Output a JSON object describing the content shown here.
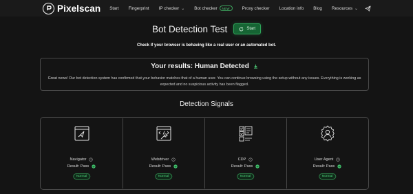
{
  "nav": {
    "brand": "Pixelscan",
    "items": [
      {
        "label": "Start",
        "chevron": false
      },
      {
        "label": "Fingerprint",
        "chevron": false
      },
      {
        "label": "IP checker",
        "chevron": true
      },
      {
        "label": "Bot checker",
        "badge": "NEW"
      },
      {
        "label": "Proxy checker",
        "chevron": false
      },
      {
        "label": "Location info",
        "chevron": false
      },
      {
        "label": "Blog",
        "chevron": false
      },
      {
        "label": "Resources",
        "chevron": true
      }
    ],
    "send_icon": "telegram-icon"
  },
  "hero": {
    "title": "Bot Detection Test",
    "start_label": "Start",
    "subtitle": "Check if your browser is behaving like a real user or an automated bot."
  },
  "result": {
    "title": "Your results: Human Detected",
    "text": "Great news! Our bot detection system has confirmed that your behavior matches that of a human user. You can continue browsing using the setup without any issues. Everything is working as expected and no suspicious activity has been flagged."
  },
  "signals": {
    "title": "Detection Signals",
    "cards": [
      {
        "name": "Navigator",
        "result": "Result: Pass",
        "status": "Normal",
        "icon": "navigator-icon"
      },
      {
        "name": "Webdriver",
        "result": "Result: Pass",
        "status": "Normal",
        "icon": "webdriver-icon"
      },
      {
        "name": "CDP",
        "result": "Result: Pass",
        "status": "Normal",
        "icon": "cdp-icon"
      },
      {
        "name": "User Agent",
        "result": "Result: Pass",
        "status": "Normal",
        "icon": "user-agent-icon"
      }
    ]
  },
  "colors": {
    "background": "#141414",
    "accent_green": "#4fd17a",
    "button_green": "#166534"
  }
}
